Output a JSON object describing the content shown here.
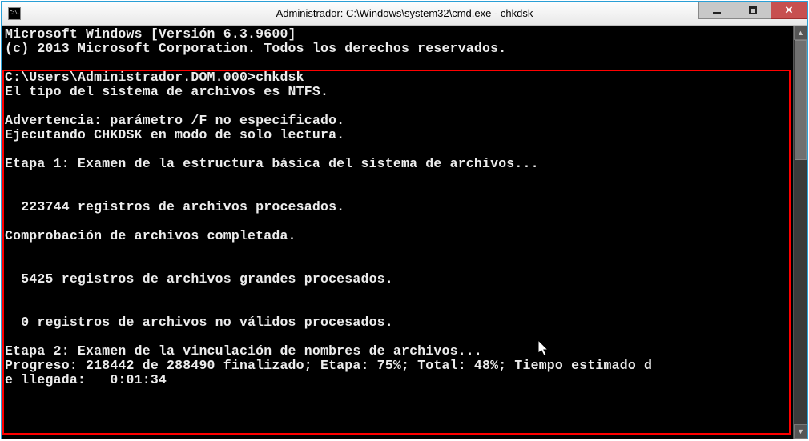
{
  "window": {
    "icon_label": "C:\\.",
    "title": "Administrador: C:\\Windows\\system32\\cmd.exe - chkdsk"
  },
  "controls": {
    "minimize": "Minimize",
    "maximize": "Maximize",
    "close": "Close"
  },
  "term": {
    "l01": "Microsoft Windows [Versión 6.3.9600]",
    "l02": "(c) 2013 Microsoft Corporation. Todos los derechos reservados.",
    "l03": "",
    "l04": "C:\\Users\\Administrador.DOM.000>chkdsk",
    "l05": "El tipo del sistema de archivos es NTFS.",
    "l06": "",
    "l07": "Advertencia: parámetro /F no especificado.",
    "l08": "Ejecutando CHKDSK en modo de solo lectura.",
    "l09": "",
    "l10": "Etapa 1: Examen de la estructura básica del sistema de archivos...",
    "l11": "",
    "l12": "",
    "l13": "  223744 registros de archivos procesados.",
    "l14": "",
    "l15": "Comprobación de archivos completada.",
    "l16": "",
    "l17": "",
    "l18": "  5425 registros de archivos grandes procesados.",
    "l19": "",
    "l20": "",
    "l21": "  0 registros de archivos no válidos procesados.",
    "l22": "",
    "l23": "Etapa 2: Examen de la vinculación de nombres de archivos...",
    "l24": "Progreso: 218442 de 288490 finalizado; Etapa: 75%; Total: 48%; Tiempo estimado d",
    "l25": "e llegada:   0:01:34"
  }
}
